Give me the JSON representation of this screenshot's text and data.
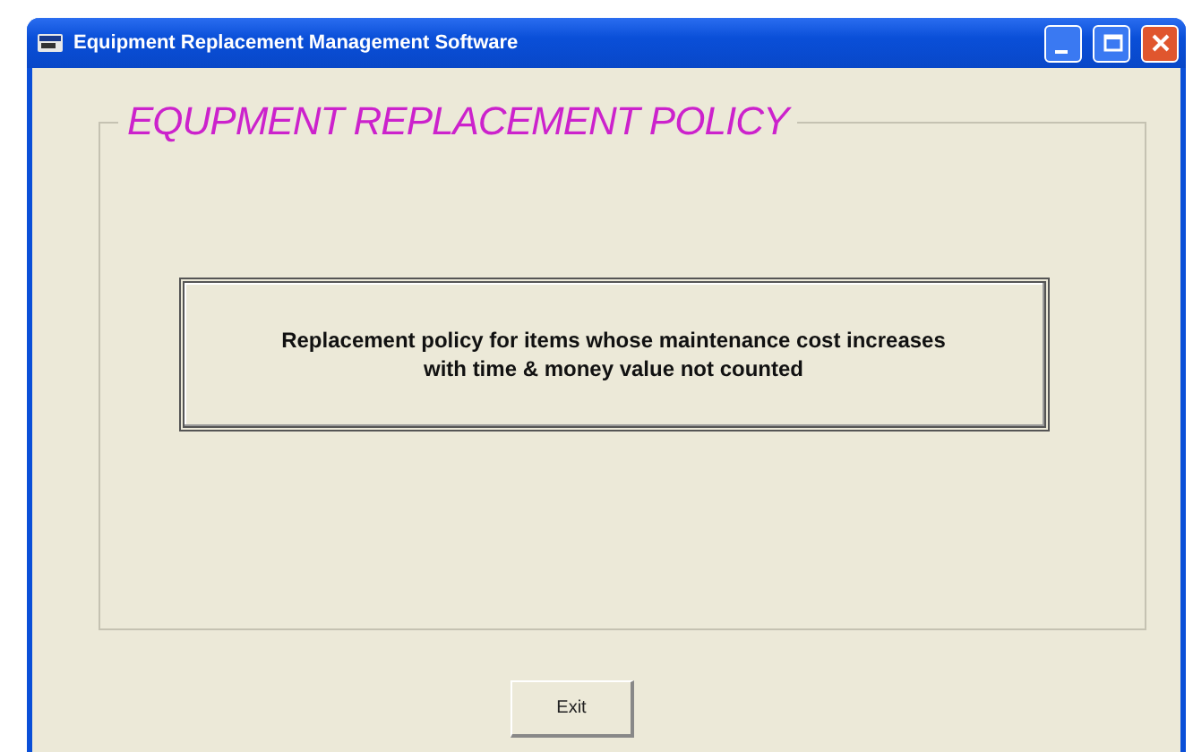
{
  "window": {
    "title": "Equipment Replacement Management Software"
  },
  "frame": {
    "legend": "EQUPMENT REPLACEMENT POLICY",
    "options": [
      {
        "label": "Replacement policy for items whose maintenance cost increases with time & money value not counted"
      }
    ]
  },
  "buttons": [
    {
      "label": "Exit"
    }
  ]
}
